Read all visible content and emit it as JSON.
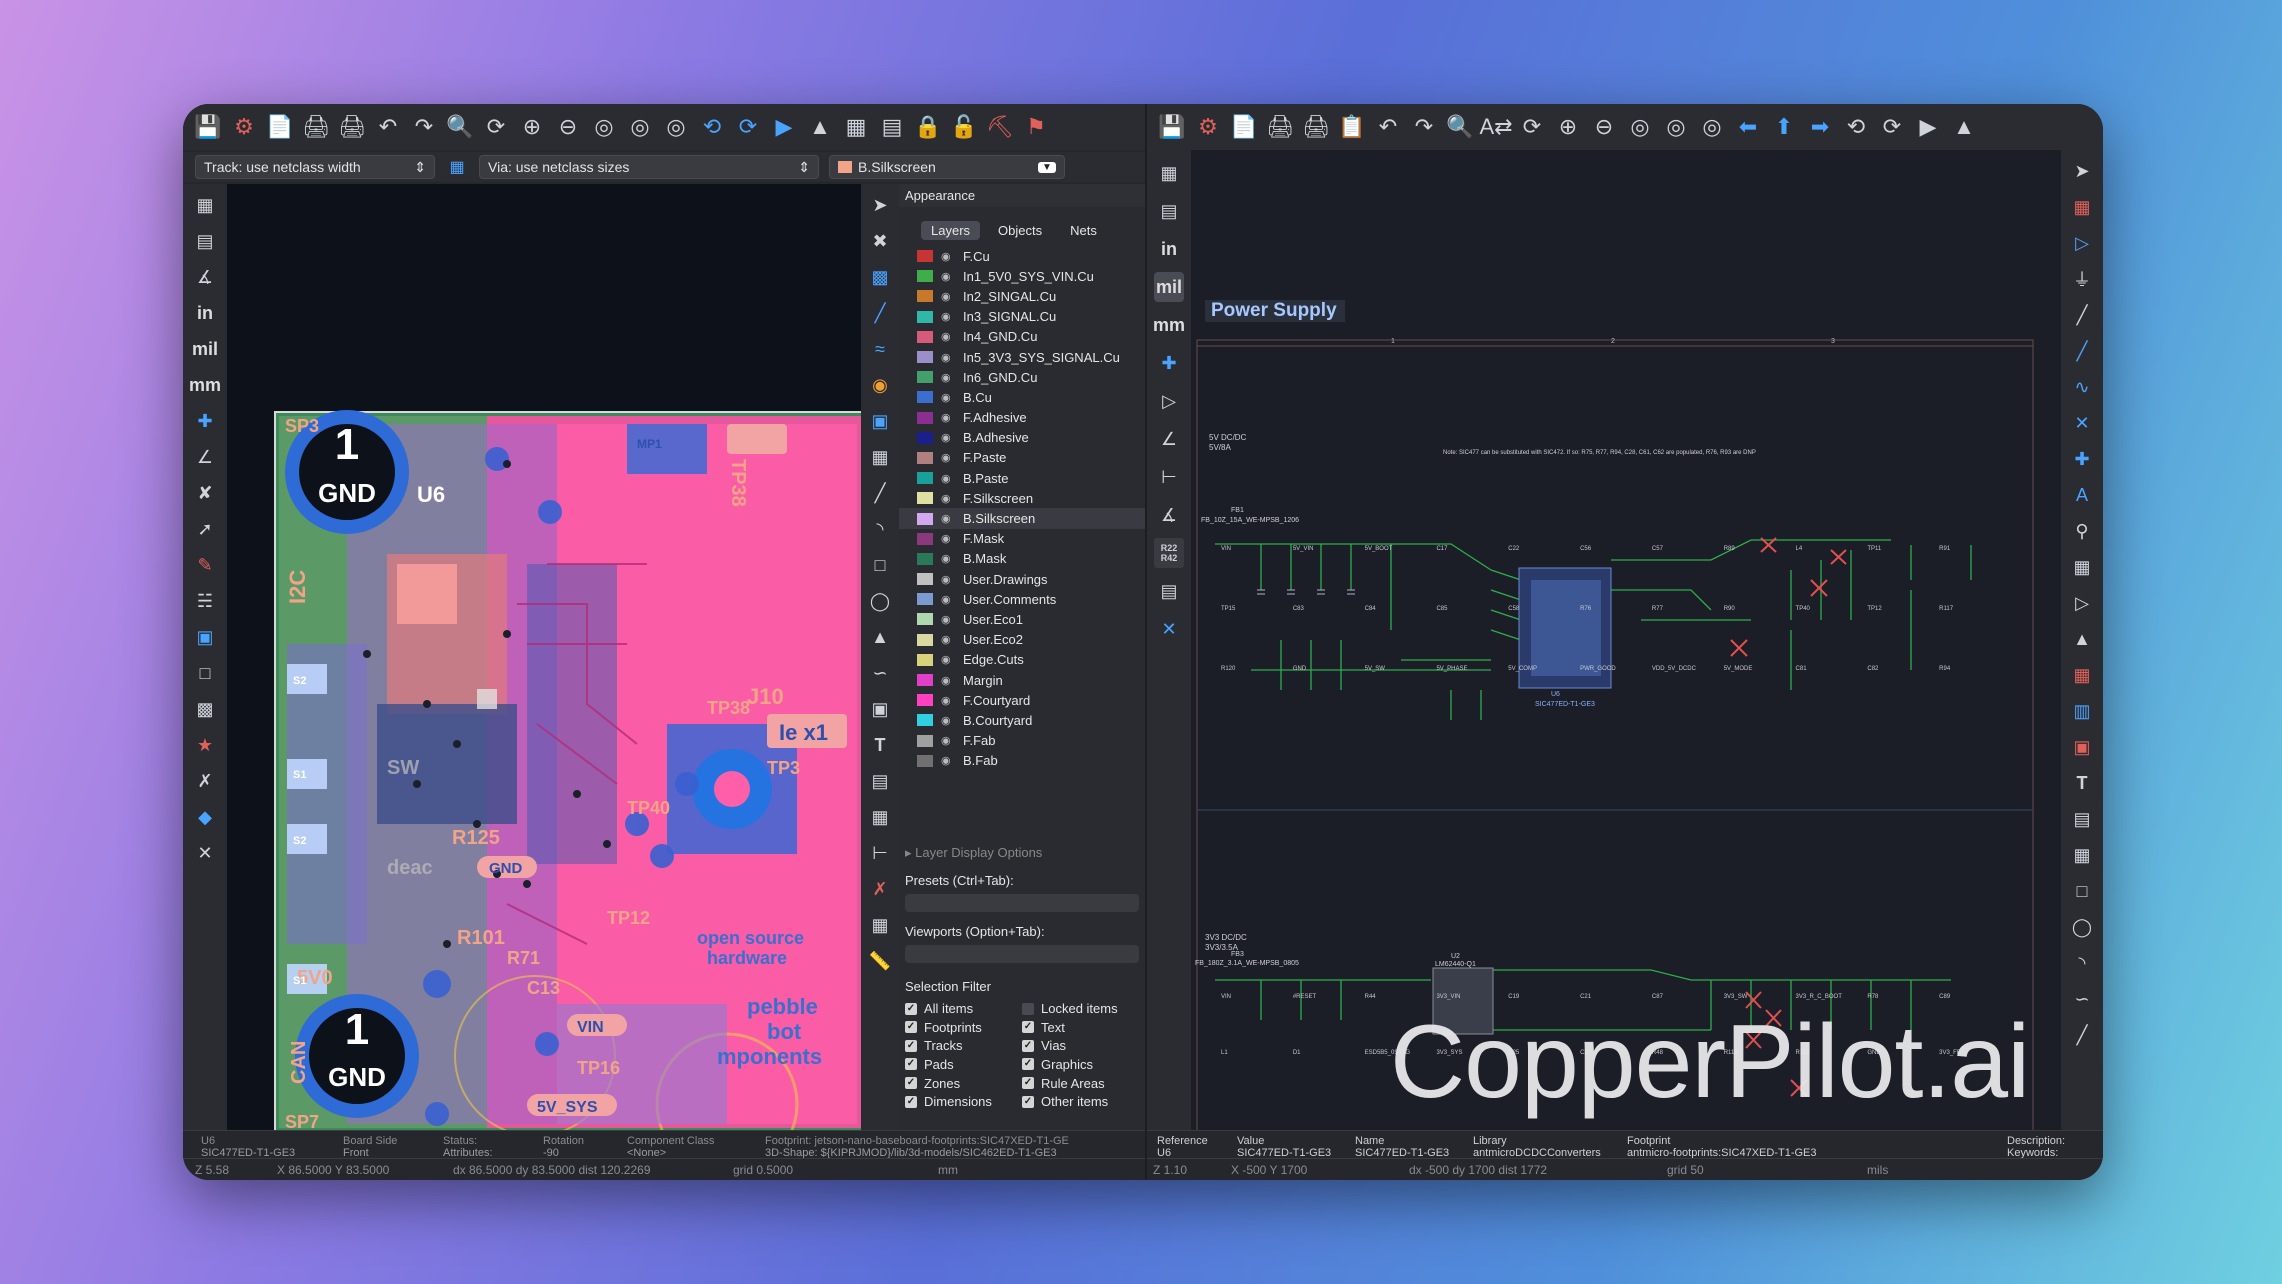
{
  "pcb": {
    "track_width": "Track: use netclass width",
    "via_size": "Via: use netclass sizes",
    "active_layer": "B.Silkscreen",
    "appearance": {
      "title": "Appearance",
      "tabs": [
        "Layers",
        "Objects",
        "Nets"
      ],
      "active_tab": "Layers",
      "layers": [
        {
          "name": "F.Cu",
          "color": "#c83434"
        },
        {
          "name": "In1_5V0_SYS_VIN.Cu",
          "color": "#3fae4a"
        },
        {
          "name": "In2_SINGAL.Cu",
          "color": "#c8782a"
        },
        {
          "name": "In3_SIGNAL.Cu",
          "color": "#2fb7a8"
        },
        {
          "name": "In4_GND.Cu",
          "color": "#d65a7a"
        },
        {
          "name": "In5_3V3_SYS_SIGNAL.Cu",
          "color": "#9c8fc9"
        },
        {
          "name": "In6_GND.Cu",
          "color": "#44a06a"
        },
        {
          "name": "B.Cu",
          "color": "#3a6fd0"
        },
        {
          "name": "F.Adhesive",
          "color": "#8a2f8f"
        },
        {
          "name": "B.Adhesive",
          "color": "#1a1f8a"
        },
        {
          "name": "F.Paste",
          "color": "#b08080"
        },
        {
          "name": "B.Paste",
          "color": "#19a09a"
        },
        {
          "name": "F.Silkscreen",
          "color": "#e0e0a0"
        },
        {
          "name": "B.Silkscreen",
          "color": "#d4a7f0"
        },
        {
          "name": "F.Mask",
          "color": "#8a3a7a"
        },
        {
          "name": "B.Mask",
          "color": "#2a7a5a"
        },
        {
          "name": "User.Drawings",
          "color": "#c0c0c0"
        },
        {
          "name": "User.Comments",
          "color": "#7a9ad0"
        },
        {
          "name": "User.Eco1",
          "color": "#b0d8b0"
        },
        {
          "name": "User.Eco2",
          "color": "#d8d8a0"
        },
        {
          "name": "Edge.Cuts",
          "color": "#d8d27a"
        },
        {
          "name": "Margin",
          "color": "#e040c8"
        },
        {
          "name": "F.Courtyard",
          "color": "#ff40c0"
        },
        {
          "name": "B.Courtyard",
          "color": "#30d0e0"
        },
        {
          "name": "F.Fab",
          "color": "#a0a0a0"
        },
        {
          "name": "B.Fab",
          "color": "#707070"
        }
      ],
      "selected_layer": "B.Silkscreen",
      "layer_display_options": "Layer Display Options",
      "presets_label": "Presets (Ctrl+Tab):",
      "viewports_label": "Viewports (Option+Tab):",
      "selection_filter_title": "Selection Filter",
      "filters": [
        {
          "label": "All items",
          "checked": true
        },
        {
          "label": "Locked items",
          "checked": false
        },
        {
          "label": "Footprints",
          "checked": true
        },
        {
          "label": "Text",
          "checked": true
        },
        {
          "label": "Tracks",
          "checked": true
        },
        {
          "label": "Vias",
          "checked": true
        },
        {
          "label": "Pads",
          "checked": true
        },
        {
          "label": "Graphics",
          "checked": true
        },
        {
          "label": "Zones",
          "checked": true
        },
        {
          "label": "Rule Areas",
          "checked": true
        },
        {
          "label": "Dimensions",
          "checked": true
        },
        {
          "label": "Other items",
          "checked": true
        }
      ]
    },
    "status": {
      "ref": "U6",
      "ref_value": "SIC477ED-T1-GE3",
      "board_side_label": "Board Side",
      "board_side": "Front",
      "status_label": "Status:",
      "attributes_label": "Attributes:",
      "rotation_label": "Rotation",
      "rotation": "-90",
      "component_class_label": "Component Class",
      "component_class": "<None>",
      "footprint": "Footprint: jetson-nano-baseboard-footprints:SIC47XED-T1-GE",
      "model_3d": "3D-Shape: ${KIPRJMOD}/lib/3d-models/SIC462ED-T1-GE3",
      "zoom": "Z 5.58",
      "xy": "X 86.5000  Y 83.5000",
      "dxdy": "dx 86.5000  dy 83.5000  dist 120.2269",
      "grid": "grid 0.5000",
      "units": "mm"
    },
    "units": {
      "in": "in",
      "mil": "mil",
      "mm": "mm"
    },
    "labels": {
      "gnd1": "GND",
      "gnd_num": "1",
      "u6": "U6",
      "i2c": "I2C",
      "can": "CAN",
      "sp3": "SP3",
      "sp7": "SP7",
      "5v0": "5V0",
      "vin": "VIN",
      "sv_sys": "5V_SYS",
      "tp38": "TP38",
      "tp3": "TP3",
      "tp12": "TP12",
      "tp40": "TP40",
      "tp16": "TP16",
      "r125": "R125",
      "r101": "R101",
      "r71": "R71",
      "c13": "C13",
      "c18": "C18",
      "j10": "J10",
      "mp1": "MP1",
      "open_source": "open source",
      "hardware": "hardware",
      "pebble": "pebble",
      "bot": "bot",
      "components": "mponents",
      "ie": "Ie x1",
      "gnd_pill": "GND",
      "deac": "deac",
      "sw": "SW",
      "s2": "S2",
      "s1": "S1"
    }
  },
  "sch": {
    "sheet_title": "Power Supply",
    "block1": {
      "title": "5V DC/DC",
      "sub": "5V/8A",
      "fb": "FB1",
      "fb_part": "FB_10Z_15A_WE-MPSB_1206",
      "note": "Note:\nSIC477 can be substituted with SIC472.\nIf so:\nR75, R77, R94, C28, C61, C62 are populated,\nR76, R93 are DNP",
      "ic": "U6",
      "ic_part": "SIC477ED-T1-GE3",
      "labels": [
        "VIN",
        "5V_VIN",
        "5V_BOOT",
        "C17",
        "C22",
        "C56",
        "C57",
        "R89",
        "L4",
        "TP11",
        "R91",
        "TP15",
        "C83",
        "C84",
        "C85",
        "C58",
        "R76",
        "R77",
        "R90",
        "TP40",
        "TP12",
        "R117",
        "R120",
        "GND",
        "5V_SW",
        "5V_PHASE",
        "5V_COMP",
        "PWR_GOOD",
        "VDD_5V_DCDC",
        "5V_MODE",
        "C81",
        "C82",
        "R94"
      ]
    },
    "block2": {
      "title": "3V3 DC/DC",
      "sub": "3V3/3.5A",
      "fb": "FB3",
      "fb_part": "FB_180Z_3.1A_WE-MPSB_0805",
      "ic": "U2",
      "ic_part": "LM62440-Q1",
      "labels": [
        "VIN",
        "#RESET",
        "R44",
        "3V3_VIN",
        "C19",
        "C21",
        "C87",
        "3V3_SW",
        "3V3_R_C_BOOT",
        "R78",
        "C89",
        "L1",
        "D1",
        "ESD5B5_0ST1G",
        "3V3_SYS",
        "C25",
        "C20",
        "R48",
        "R118",
        "R119",
        "GND",
        "3V3_FB"
      ]
    },
    "status": {
      "reference_label": "Reference",
      "reference": "U6",
      "value_label": "Value",
      "value": "SIC477ED-T1-GE3",
      "name_label": "Name",
      "name": "SIC477ED-T1-GE3",
      "library_label": "Library",
      "library": "antmicroDCDCConverters",
      "footprint_label": "Footprint",
      "footprint": "antmicro-footprints:SIC47XED-T1-GE3",
      "description_label": "Description:",
      "keywords_label": "Keywords:",
      "zoom": "Z 1.10",
      "xy": "X -500  Y 1700",
      "dxdy": "dx -500  dy 1700  dist 1772",
      "grid": "grid 50",
      "units": "mils"
    },
    "units": {
      "in": "in",
      "mil": "mil",
      "mm": "mm"
    },
    "badge": "R22\nR42"
  },
  "watermark": "CopperPilot.ai"
}
